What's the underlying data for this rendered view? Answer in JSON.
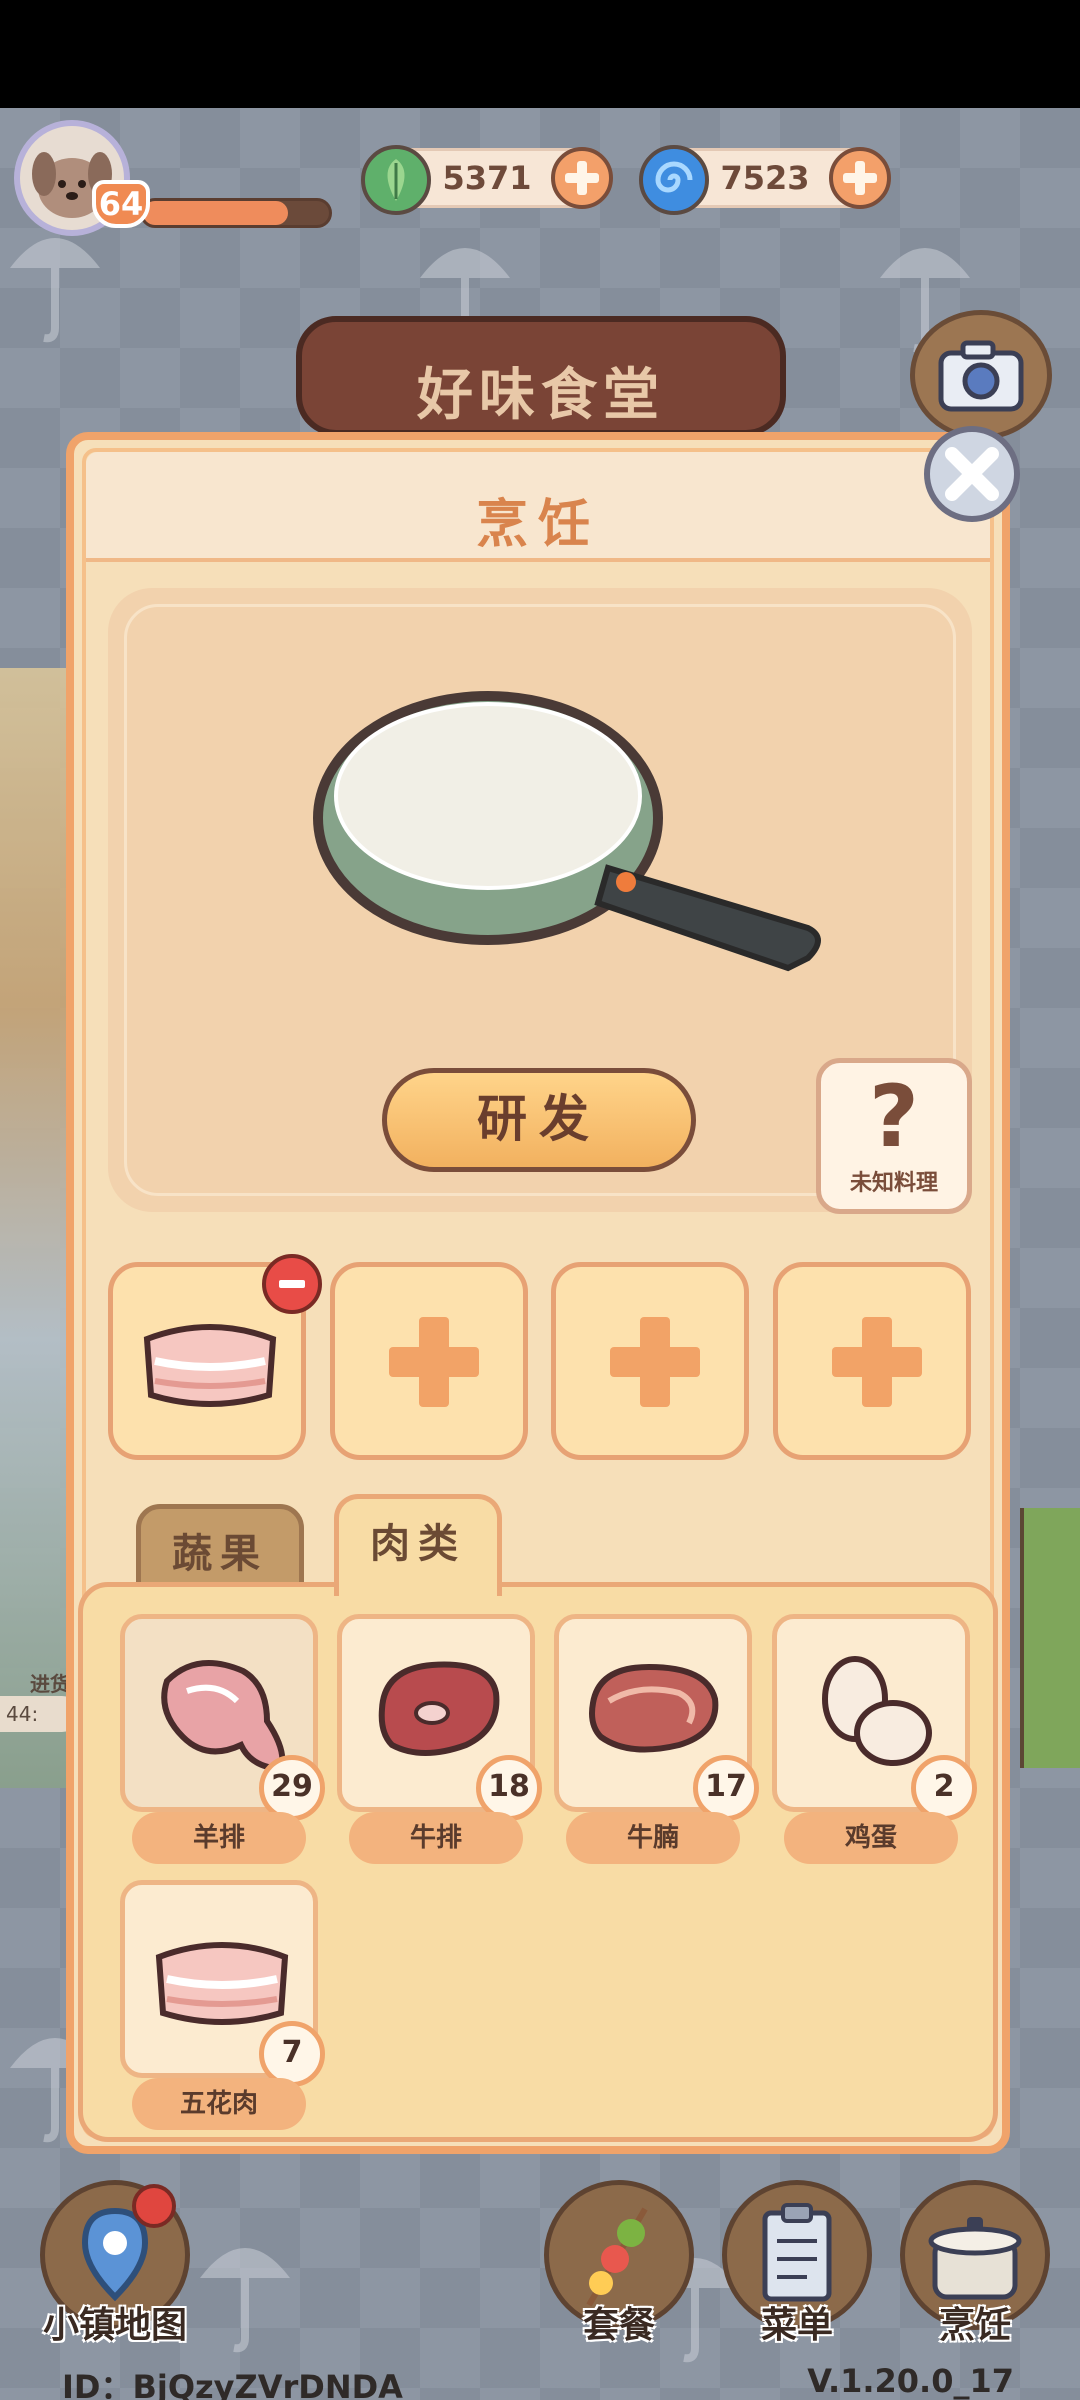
{
  "hud": {
    "level": "64",
    "xp_fraction": 0.78,
    "currencies": [
      {
        "name": "leaf-currency",
        "value": "5371",
        "color": "#5fb06b"
      },
      {
        "name": "swirl-currency",
        "value": "7523",
        "color": "#3f8de0"
      }
    ]
  },
  "sign": {
    "title": "好味食堂"
  },
  "panel": {
    "title": "烹饪",
    "research_button": "研发",
    "unknown_dish": {
      "symbol": "?",
      "label": "未知料理"
    }
  },
  "selected_slots": [
    {
      "filled": true,
      "ingredient": "五花肉"
    },
    {
      "filled": false
    },
    {
      "filled": false
    },
    {
      "filled": false
    }
  ],
  "tabs": [
    {
      "label": "蔬果",
      "active": false
    },
    {
      "label": "肉类",
      "active": true
    }
  ],
  "ingredients": [
    {
      "name": "羊排",
      "count": "29",
      "icon": "lamb-chop-icon"
    },
    {
      "name": "牛排",
      "count": "18",
      "icon": "steak-icon"
    },
    {
      "name": "牛腩",
      "count": "17",
      "icon": "beef-brisket-icon"
    },
    {
      "name": "鸡蛋",
      "count": "2",
      "icon": "egg-icon"
    },
    {
      "name": "五花肉",
      "count": "7",
      "icon": "pork-belly-icon"
    }
  ],
  "side": {
    "label": "进货",
    "counter": "44:"
  },
  "bottom_nav": [
    {
      "label": "小镇地图",
      "icon": "map-pin-icon",
      "has_alert": true
    },
    {
      "label": "套餐",
      "icon": "skewer-icon"
    },
    {
      "label": "菜单",
      "icon": "clipboard-icon"
    },
    {
      "label": "烹饪",
      "icon": "cooking-pot-icon"
    }
  ],
  "footer": {
    "id": "ID：BjQzyZVrDNDA",
    "version": "V.1.20.0_17"
  }
}
